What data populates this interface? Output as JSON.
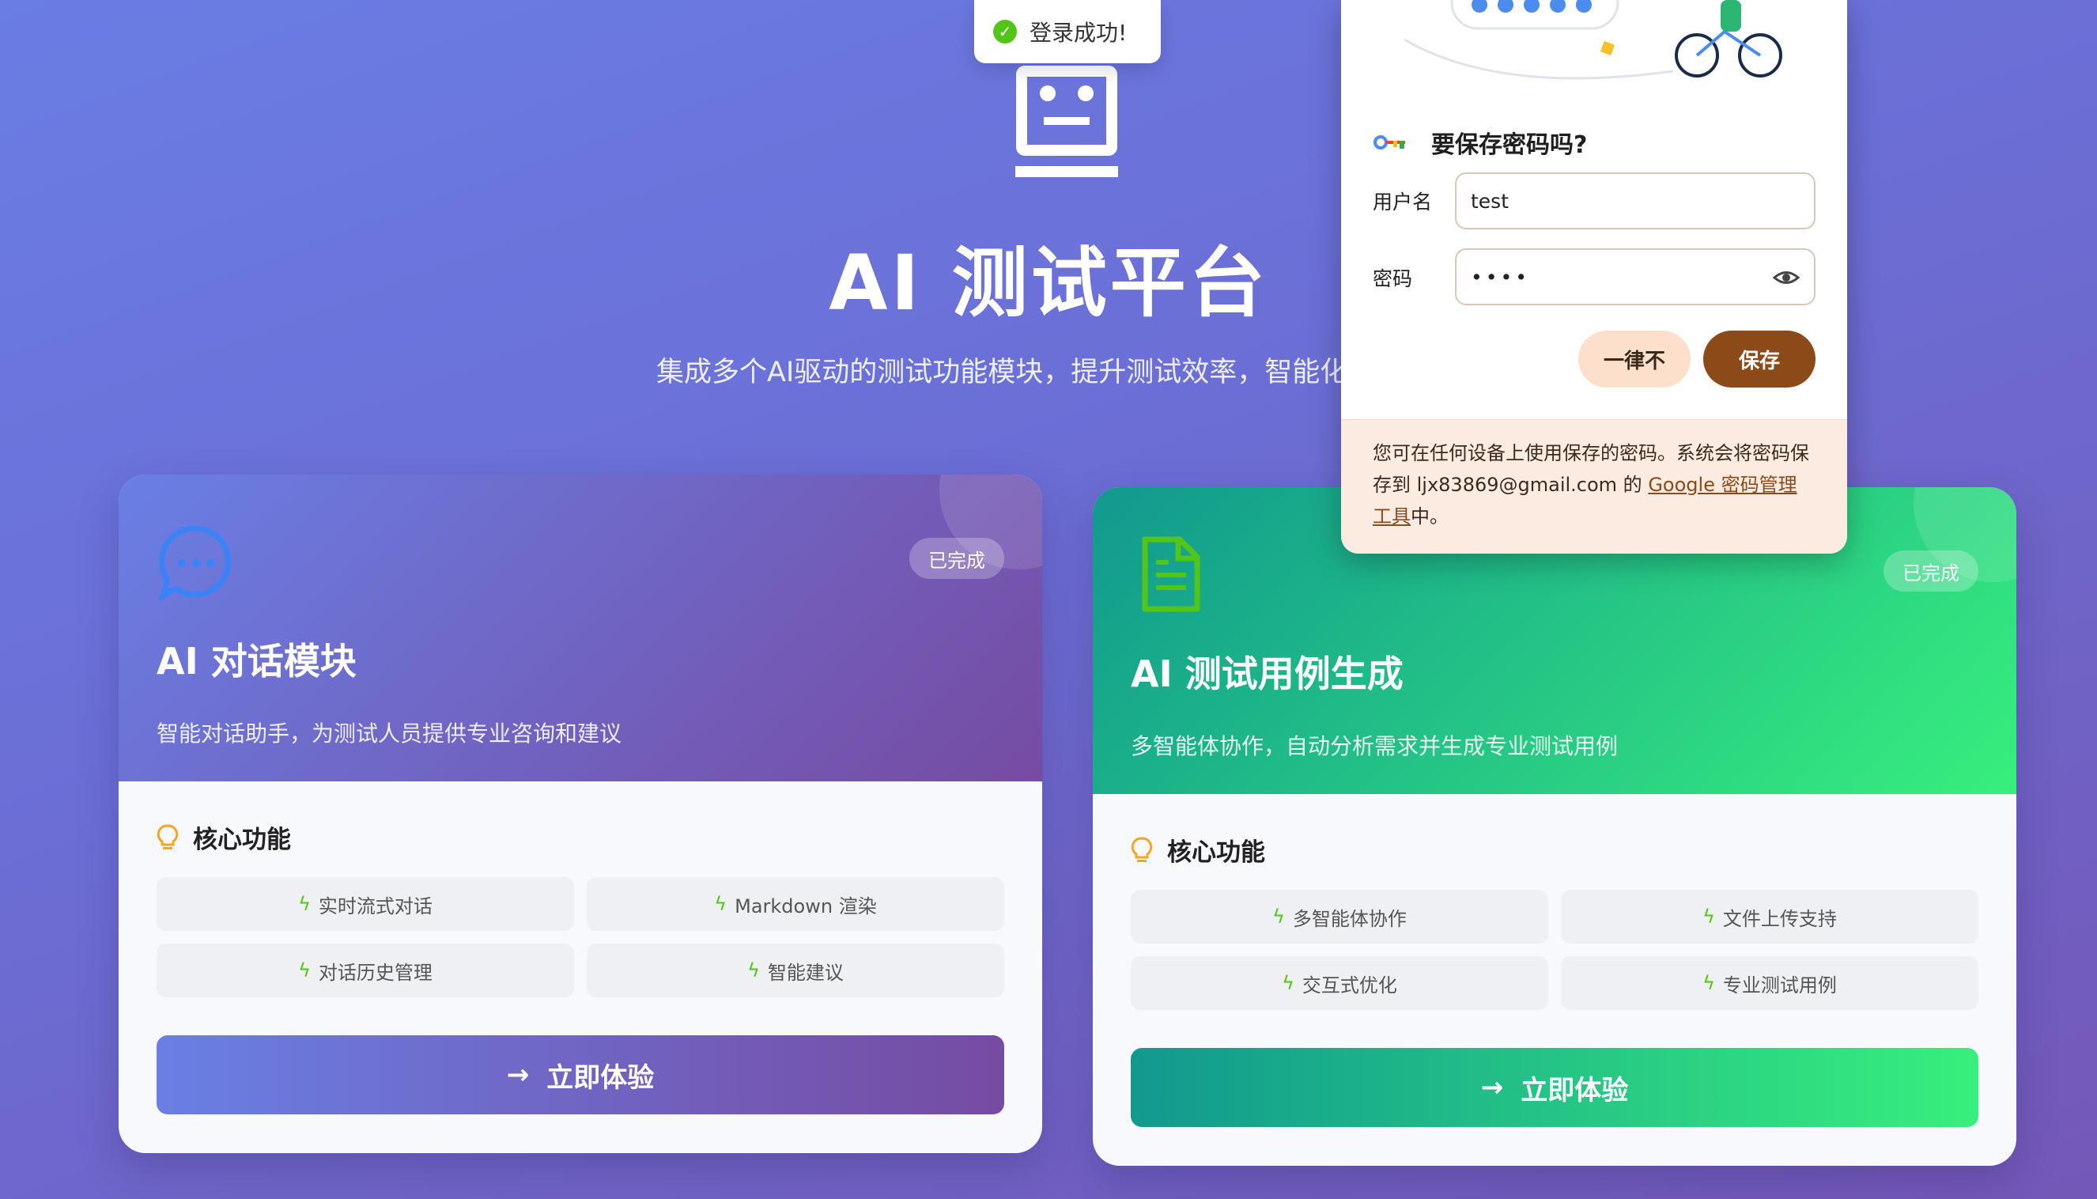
{
  "toast": {
    "text": "登录成功!",
    "icon": "check-circle-icon"
  },
  "hero": {
    "title": "AI 测试平台",
    "subtitle": "集成多个AI驱动的测试功能模块，提升测试效率，智能化"
  },
  "cards": [
    {
      "icon": "chat-bubble-icon",
      "badge": "已完成",
      "title": "AI 对话模块",
      "desc": "智能对话助手，为测试人员提供专业咨询和建议",
      "features_heading": "核心功能",
      "features": [
        "实时流式对话",
        "Markdown 渲染",
        "对话历史管理",
        "智能建议"
      ],
      "cta": "立即体验",
      "accent": "#667eea"
    },
    {
      "icon": "document-icon",
      "badge": "已完成",
      "title": "AI 测试用例生成",
      "desc": "多智能体协作，自动分析需求并生成专业测试用例",
      "features_heading": "核心功能",
      "features": [
        "多智能体协作",
        "文件上传支持",
        "交互式优化",
        "专业测试用例"
      ],
      "cta": "立即体验",
      "accent": "#11998e"
    }
  ],
  "password_popup": {
    "title": "要保存密码吗?",
    "username_label": "用户名",
    "username_value": "test",
    "password_label": "密码",
    "password_value": "••••",
    "never_label": "一律不",
    "save_label": "保存",
    "footer_before": "您可在任何设备上使用保存的密码。系统会将密码保存到 ljx83869@gmail.com 的 ",
    "footer_link": "Google 密码管理工具",
    "footer_after": "中。"
  }
}
